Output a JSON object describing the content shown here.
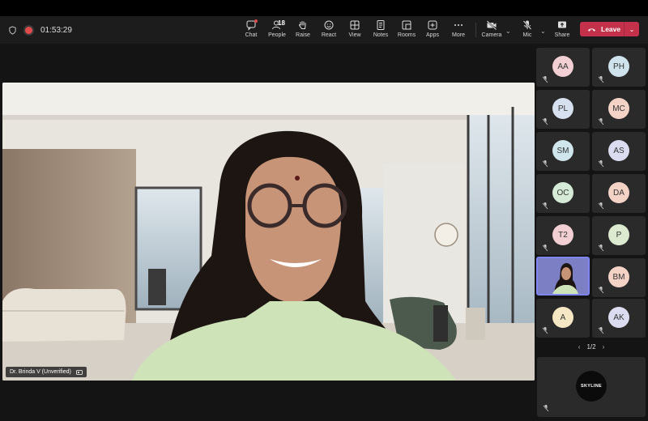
{
  "meeting": {
    "timer": "01:53:29"
  },
  "toolbar": {
    "chat": "Chat",
    "people": "People",
    "people_count": "18",
    "raise": "Raise",
    "react": "React",
    "view": "View",
    "notes": "Notes",
    "rooms": "Rooms",
    "apps": "Apps",
    "more": "More",
    "camera": "Camera",
    "mic": "Mic",
    "share": "Share",
    "leave": "Leave"
  },
  "stage": {
    "speaker_name": "Dr. Brinda V (Unverified)"
  },
  "participants": [
    {
      "initials": "AA",
      "color": "#f1cfd2"
    },
    {
      "initials": "PH",
      "color": "#cfe3ec"
    },
    {
      "initials": "PL",
      "color": "#d7e0ee"
    },
    {
      "initials": "MC",
      "color": "#f4d3c7"
    },
    {
      "initials": "SM",
      "color": "#cfe6ec"
    },
    {
      "initials": "AS",
      "color": "#dcdcf1"
    },
    {
      "initials": "OC",
      "color": "#d5ebd7"
    },
    {
      "initials": "DA",
      "color": "#f4d3c7"
    },
    {
      "initials": "T2",
      "color": "#f1cfd2"
    },
    {
      "initials": "P",
      "color": "#dcebcf"
    },
    {
      "initials": "",
      "color": "#4b4e8f"
    },
    {
      "initials": "BM",
      "color": "#f4d3c7"
    },
    {
      "initials": "A",
      "color": "#f6e7c4"
    },
    {
      "initials": "AK",
      "color": "#dcdcf1"
    }
  ],
  "pager": {
    "label": "1/2"
  },
  "self_view": {
    "logo_text": "SKYLINE"
  }
}
